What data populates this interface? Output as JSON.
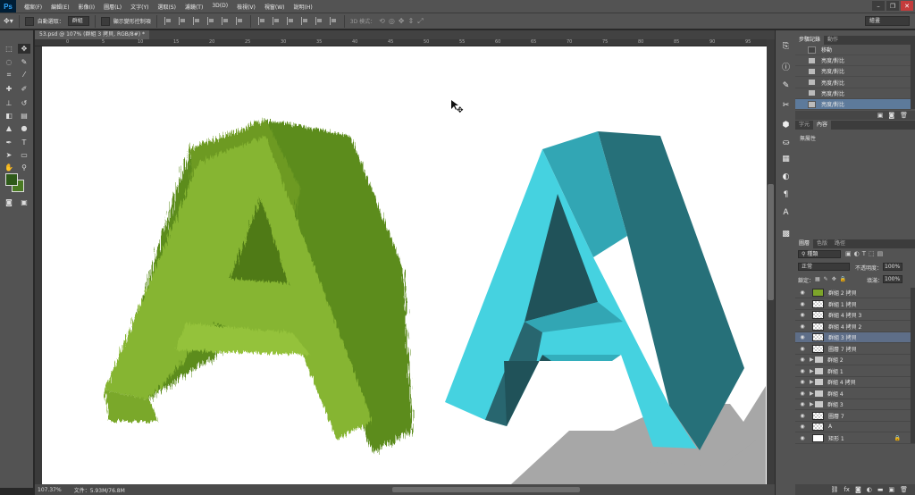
{
  "menubar": {
    "logo": "Ps",
    "items": [
      "檔案(F)",
      "編輯(E)",
      "影像(I)",
      "圖層(L)",
      "文字(Y)",
      "選取(S)",
      "濾鏡(T)",
      "3D(D)",
      "檢視(V)",
      "視窗(W)",
      "說明(H)"
    ]
  },
  "options": {
    "auto_select_label": "自動選取：",
    "auto_select_value": "群組",
    "transform_label": "顯示變形控制項",
    "mode3d_label": "3D 模式：",
    "workspace": "繪畫"
  },
  "document": {
    "tab_title": "53.psd @ 107% (群組 3 拷貝, RGB/8#) *",
    "ruler_numbers": [
      "0",
      "5",
      "10",
      "15",
      "20",
      "25",
      "30",
      "35",
      "40",
      "45",
      "50",
      "55",
      "60",
      "65",
      "70",
      "75",
      "80",
      "85",
      "90",
      "95"
    ],
    "zoom": "107.37%",
    "doc_size": "文件：5.93M/76.8M"
  },
  "history_panel": {
    "tabs": [
      "步驟記錄",
      "動作"
    ],
    "items": [
      "移動",
      "亮度/對比",
      "亮度/對比",
      "亮度/對比",
      "亮度/對比",
      "亮度/對比"
    ]
  },
  "props_panel": {
    "tabs": [
      "字元",
      "內容"
    ],
    "content": "無屬性"
  },
  "layers_panel": {
    "tabs": [
      "圖層",
      "色版",
      "路徑"
    ],
    "filter_label": "種類",
    "blend_mode": "正常",
    "opacity_label": "不透明度：",
    "opacity": "100%",
    "lock_label": "鎖定：",
    "fill_label": "填滿：",
    "fill": "100%",
    "layers": [
      {
        "name": "群組 2 拷貝",
        "kind": "layer",
        "thumb": "green"
      },
      {
        "name": "群組 1 拷貝",
        "kind": "layer",
        "thumb": "checker"
      },
      {
        "name": "群組 4 拷貝 3",
        "kind": "layer",
        "thumb": "checker"
      },
      {
        "name": "群組 4 拷貝 2",
        "kind": "layer",
        "thumb": "checker"
      },
      {
        "name": "群組 3 拷貝",
        "kind": "layer",
        "thumb": "checker",
        "selected": true
      },
      {
        "name": "圖層 7 拷貝",
        "kind": "layer",
        "thumb": "checker"
      },
      {
        "name": "群組 2",
        "kind": "group"
      },
      {
        "name": "群組 1",
        "kind": "group"
      },
      {
        "name": "群組 4 拷貝",
        "kind": "group"
      },
      {
        "name": "群組 4",
        "kind": "group"
      },
      {
        "name": "群組 3",
        "kind": "group"
      },
      {
        "name": "圖層 7",
        "kind": "layer",
        "thumb": "checker"
      },
      {
        "name": "A",
        "kind": "layer",
        "thumb": "checker"
      },
      {
        "name": "矩形 1",
        "kind": "layer",
        "thumb": "white",
        "locked": true
      }
    ]
  },
  "colors": {
    "foreground": "#2f5a1a",
    "background": "#4a7a23",
    "selection": "#5e6e88"
  }
}
